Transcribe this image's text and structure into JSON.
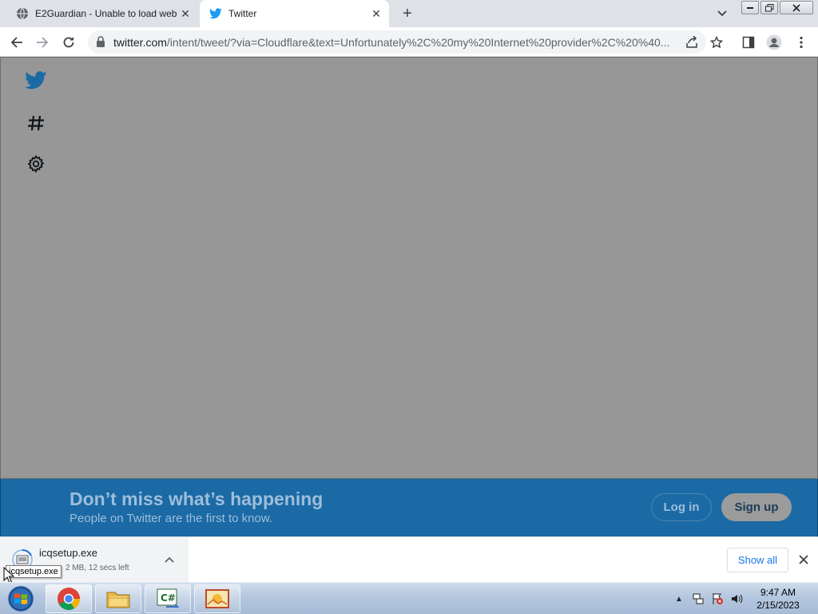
{
  "browser": {
    "tabs": [
      {
        "title": "E2Guardian - Unable to load web",
        "favicon": "globe-icon",
        "active": false
      },
      {
        "title": "Twitter",
        "favicon": "twitter-bird-icon",
        "active": true
      }
    ],
    "address_bar": {
      "host": "twitter.com",
      "path": "/intent/tweet/?via=Cloudflare&text=Unfortunately%2C%20my%20Internet%20provider%2C%20%40..."
    }
  },
  "page": {
    "overlay_color": "#979797",
    "sidebar_icons": [
      "twitter-bird-icon",
      "hashtag-icon",
      "settings-gear-icon"
    ],
    "banner": {
      "headline": "Don’t miss what’s happening",
      "subtext": "People on Twitter are the first to know.",
      "login_label": "Log in",
      "signup_label": "Sign up",
      "background": "#1b6aa5"
    }
  },
  "download_shelf": {
    "file_name": "icqsetup.exe",
    "status": "2 MB, 12 secs left",
    "tooltip": "icqsetup.exe",
    "show_all_label": "Show all"
  },
  "taskbar": {
    "apps": [
      "windows-start-orb",
      "chrome-icon",
      "file-explorer-icon",
      "csharp-app-icon",
      "image-viewer-icon"
    ],
    "clock": {
      "time": "9:47 AM",
      "date": "2/15/2023"
    }
  }
}
